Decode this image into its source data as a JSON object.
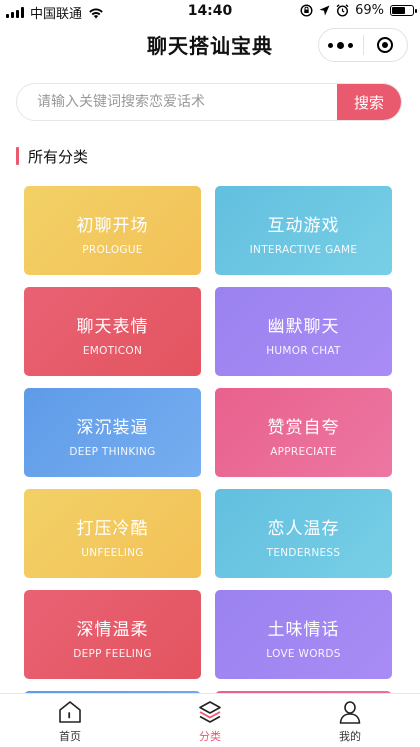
{
  "status_bar": {
    "carrier": "中国联通",
    "time": "14:40",
    "battery_percent": "69%",
    "battery_level": 0.69
  },
  "nav": {
    "title": "聊天搭讪宝典",
    "more_icon": "more-dots-icon",
    "close_icon": "target-icon"
  },
  "search": {
    "placeholder": "请输入关键词搜索恋爱话术",
    "button_label": "搜索"
  },
  "section": {
    "title": "所有分类"
  },
  "categories": [
    {
      "cn": "初聊开场",
      "en": "PROLOGUE",
      "color": "#f2cb5f"
    },
    {
      "cn": "互动游戏",
      "en": "INTERACTIVE GAME",
      "color": "#6cc6e3"
    },
    {
      "cn": "聊天表情",
      "en": "EMOTICON",
      "color": "#e55b6b"
    },
    {
      "cn": "幽默聊天",
      "en": "HUMOR CHAT",
      "color": "#a087f2"
    },
    {
      "cn": "深沉装逼",
      "en": "DEEP THINKING",
      "color": "#6aa4ec"
    },
    {
      "cn": "赞赏自夸",
      "en": "APPRECIATE",
      "color": "#ea6b97"
    },
    {
      "cn": "打压冷酷",
      "en": "UNFEELING",
      "color": "#f2cb5f"
    },
    {
      "cn": "恋人温存",
      "en": "TENDERNESS",
      "color": "#6cc6e3"
    },
    {
      "cn": "深情温柔",
      "en": "DEPP FEELING",
      "color": "#e55b6b"
    },
    {
      "cn": "土味情话",
      "en": "LOVE WORDS",
      "color": "#a087f2"
    }
  ],
  "tabbar": {
    "items": [
      {
        "label": "首页",
        "icon": "home-icon"
      },
      {
        "label": "分类",
        "icon": "layers-icon"
      },
      {
        "label": "我的",
        "icon": "user-icon"
      }
    ],
    "active_color": "#e95a6f"
  }
}
